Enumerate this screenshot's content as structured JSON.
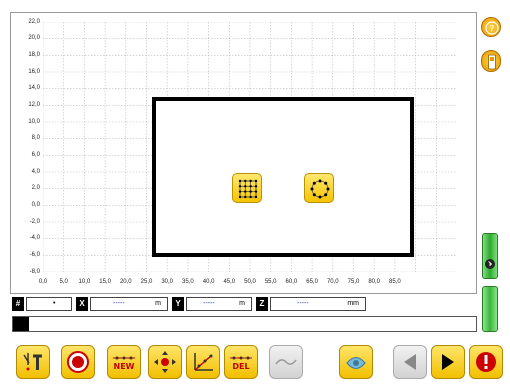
{
  "plot": {
    "y_ticks": [
      "22,0",
      "20,0",
      "18,0",
      "16,0",
      "14,0",
      "12,0",
      "10,0",
      "8,0",
      "6,0",
      "4,0",
      "2,0",
      "0,0",
      "-2,0",
      "-4,0",
      "-6,0",
      "-8,0"
    ],
    "x_ticks": [
      "0,0",
      "5,0",
      "10,0",
      "15,0",
      "20,0",
      "25,0",
      "30,0",
      "35,0",
      "40,0",
      "45,0",
      "50,0",
      "55,0",
      "60,0",
      "65,0",
      "70,0",
      "75,0",
      "80,0",
      "85,0"
    ],
    "grid": true
  },
  "dialog": {
    "grid_points_button_icon": "grid-points-icon",
    "circle_points_button_icon": "circle-points-icon"
  },
  "fields": {
    "index_label": "#",
    "index_value": "•",
    "x_label": "X",
    "x_value": "-----",
    "x_unit": "m",
    "y_label": "Y",
    "y_value": "-----",
    "y_unit": "m",
    "z_label": "Z",
    "z_value": "-----",
    "z_unit": "mm"
  },
  "toolbar": {
    "new_label": "NEW",
    "del_label": "DEL"
  },
  "colors": {
    "accent": "#f5c400",
    "battery": "#3cb43c",
    "record": "#cc0000"
  }
}
